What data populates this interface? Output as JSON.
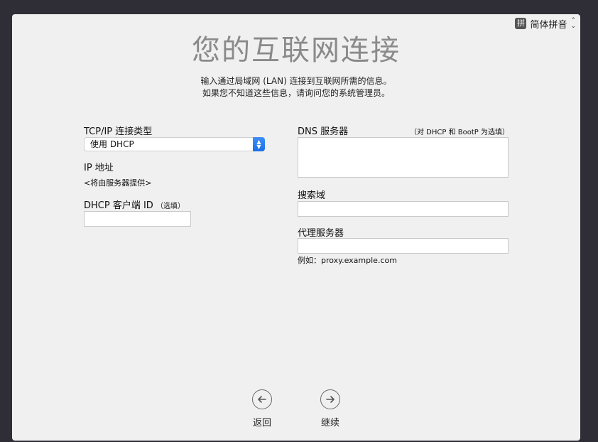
{
  "ime": {
    "badge": "拼",
    "label": "简体拼音",
    "icon": "input-method-icon"
  },
  "header": {
    "title": "您的互联网连接",
    "subtitle_line1": "输入通过局域网 (LAN) 连接到互联网所需的信息。",
    "subtitle_line2": "如果您不知道这些信息，请询问您的系统管理员。"
  },
  "left": {
    "connection_type_label": "TCP/IP 连接类型",
    "connection_type_value": "使用 DHCP",
    "ip_label": "IP 地址",
    "ip_value": "<将由服务器提供>",
    "dhcp_client_label": "DHCP 客户端 ID",
    "dhcp_client_optional": "（选填）",
    "dhcp_client_value": ""
  },
  "right": {
    "dns_label": "DNS 服务器",
    "dns_note": "（对 DHCP 和 BootP 为选填）",
    "dns_value": "",
    "search_domain_label": "搜索域",
    "search_domain_value": "",
    "proxy_label": "代理服务器",
    "proxy_value": "",
    "proxy_example": "例如：proxy.example.com"
  },
  "nav": {
    "back_label": "返回",
    "continue_label": "继续"
  }
}
